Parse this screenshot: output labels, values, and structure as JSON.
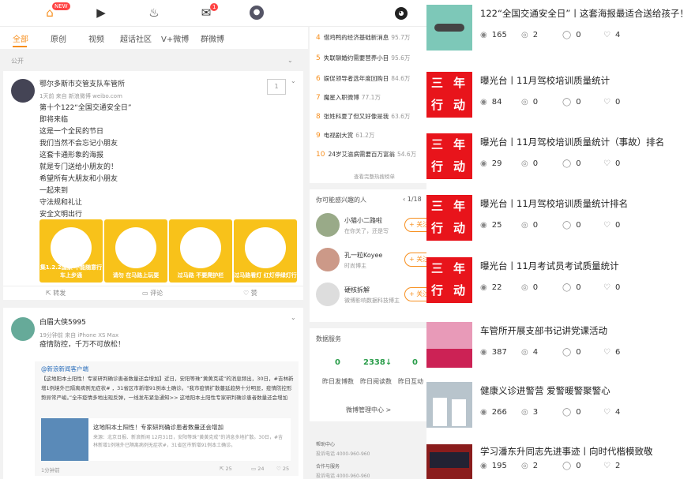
{
  "topnav": {
    "new_badge": "NEW",
    "mail_badge": "1"
  },
  "tabs": [
    "全部",
    "原创",
    "视频",
    "超话社区",
    "V+微博",
    "群微博"
  ],
  "feed_label": "公开",
  "post1": {
    "author": "鄂尔多斯市交管支队车管所",
    "meta": "1天前 来自 新浪微博 weibo.com",
    "vip": "1",
    "lines": [
      "第十个122“全国交通安全日”",
      "即将来临",
      "这是一个全民的节日",
      "我们当然不会忘记小朋友",
      "这套卡通形象的海报",
      "就是专门送给小朋友的！",
      "希望所有大朋友和小朋友",
      "一起来到",
      "守法规和礼让",
      "安全文明出行"
    ],
    "images": [
      "集1.2.2国家\n不能随意行车上步通",
      "请勿\n在马路上玩耍",
      "过马路\n不要爬护栏",
      "过马路看灯\n红灯停绿灯行"
    ],
    "actions": [
      "转发",
      "评论",
      "赞"
    ]
  },
  "post2": {
    "author": "白眉大侠5995",
    "meta": "19分钟前 来自 iPhone XS Max",
    "text": "疫情防控，千万不可放松！",
    "repost_source": "@新浪新闻客户端",
    "repost_text": "【这地阳本土阳性！专家研判确诊患者数量还会增加】近日，安阳等珠“黄黄克戒”的消息频出，30日，#吉林新增1例境外已隔离病例无症状# ，31省区市新增91例本土确诊。“我市疫情扩散蔓延趋势十分明显，疫情防控形势异常严峻。”全市疫情多地出现反弹，一线发布紧急通知>> 这地阳本土阳性专家研判确诊患者数量还会增加",
    "link_title": "这地阳本土阳性！专家研判确诊患者数量还会增加",
    "link_desc": "来源：北京日报、新浪新闻 12月31日，安阳等珠“黄黄克戒”的消息多地扩散。30日，#吉林新增1例境外已隔离病例无症状#，31省区市新增91例本土确诊。",
    "counts": [
      "25",
      "24",
      "25"
    ],
    "time": "1分钟前"
  },
  "hot_list": {
    "items": [
      {
        "n": "4",
        "t": "借鸡鸭的经济基础新消息",
        "v": "95.7万"
      },
      {
        "n": "5",
        "t": "失联聊婚约需要营养小目",
        "v": "95.6万"
      },
      {
        "n": "6",
        "t": "娱促领导者选年度回购日",
        "v": "84.6万"
      },
      {
        "n": "7",
        "t": "魔星入职微博",
        "v": "77.1万"
      },
      {
        "n": "8",
        "t": "张姓科夏了但又好像是我",
        "v": "63.6万"
      },
      {
        "n": "9",
        "t": "电视剧大赏",
        "v": "61.2万"
      },
      {
        "n": "10",
        "t": "24岁艾滋病需要百万富翁",
        "v": "54.6万"
      }
    ],
    "more": "查看完整热搜榜单"
  },
  "suggest": {
    "title": "你可能感兴趣的人",
    "pager": "1/18",
    "follow": "+ 关注",
    "people": [
      {
        "name": "小猫小二路啦",
        "desc": "在你关了，还是写"
      },
      {
        "name": "孔一粒Koyee",
        "desc": "时尚博主"
      },
      {
        "name": "硬核拆解",
        "desc": "微博影响数据科技博主"
      }
    ]
  },
  "data_service": {
    "title": "数据服务",
    "values": [
      "0",
      "2338↓",
      "0"
    ],
    "labels": [
      "昨日发博数",
      "昨日阅读数",
      "昨日互动"
    ],
    "manage": "微博管理中心 >"
  },
  "footer": {
    "help": "帮助中心",
    "phone1": "投诉电话 4000-960-960",
    "cooperate": "合作与服务",
    "phone2": "投诉电话 4000-960-960"
  },
  "right_items": [
    {
      "title": "122“全国交通安全日”丨这套海报最适合送给孩子！",
      "stats": [
        "165",
        "2",
        "0",
        "4"
      ]
    },
    {
      "title": "曝光台丨11月驾校培训质量统计",
      "stats": [
        "84",
        "0",
        "0",
        "0"
      ]
    },
    {
      "title": "曝光台丨11月驾校培训质量统计（事故）排名",
      "stats": [
        "29",
        "0",
        "0",
        "0"
      ]
    },
    {
      "title": "曝光台丨11月驾校培训质量统计排名",
      "stats": [
        "25",
        "0",
        "0",
        "0"
      ]
    },
    {
      "title": "曝光台丨11月考试员考试质量统计",
      "stats": [
        "22",
        "0",
        "0",
        "0"
      ]
    },
    {
      "title": "车管所开展支部书记讲党课活动",
      "stats": [
        "387",
        "4",
        "0",
        "6"
      ]
    },
    {
      "title": "健康义诊进警营 爱警暖警聚警心",
      "stats": [
        "266",
        "3",
        "0",
        "4"
      ]
    },
    {
      "title": "学习潘东升同志先进事迹丨向时代楷模致敬",
      "stats": [
        "195",
        "2",
        "0",
        "2"
      ]
    }
  ],
  "slogan": [
    "三",
    "年",
    "行",
    "动"
  ],
  "stat_icons": [
    "view-icon",
    "share-icon",
    "comment-icon",
    "like-icon"
  ]
}
